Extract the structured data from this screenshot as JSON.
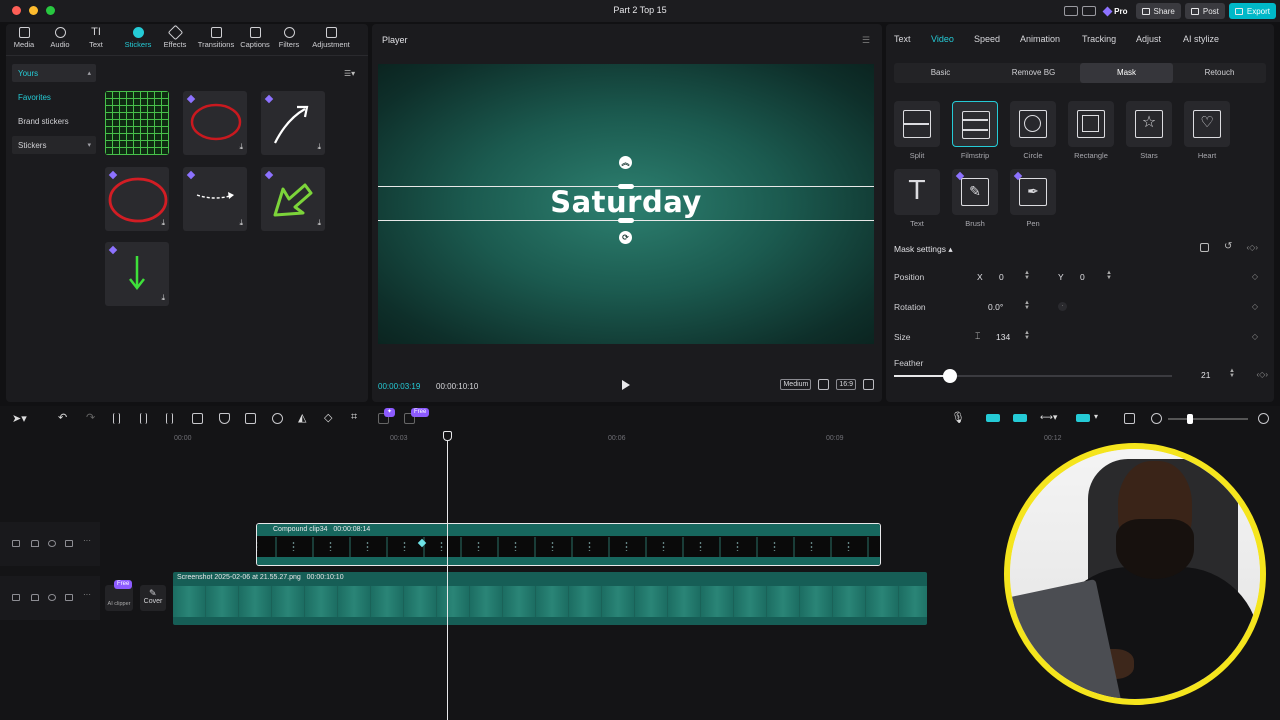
{
  "window": {
    "title": "Part 2 Top 15"
  },
  "titlebar": {
    "pro_label": "Pro",
    "share_label": "Share",
    "post_label": "Post",
    "export_label": "Export"
  },
  "library": {
    "tabs": [
      {
        "label": "Media"
      },
      {
        "label": "Audio"
      },
      {
        "label": "Text"
      },
      {
        "label": "Stickers"
      },
      {
        "label": "Effects"
      },
      {
        "label": "Transitions"
      },
      {
        "label": "Captions"
      },
      {
        "label": "Filters"
      },
      {
        "label": "Adjustment"
      }
    ],
    "active_tab": "Stickers",
    "side": {
      "yours": "Yours",
      "favorites": "Favorites",
      "brand_stickers": "Brand stickers",
      "stickers": "Stickers"
    }
  },
  "player": {
    "title": "Player",
    "canvas_text": "Saturday",
    "current_time": "00:00:03:19",
    "duration": "00:00:10:10",
    "quality": "Medium",
    "ratio": "16:9"
  },
  "props": {
    "tabs": [
      "Text",
      "Video",
      "Speed",
      "Animation",
      "Tracking",
      "Adjust",
      "AI stylize"
    ],
    "active_tab": "Video",
    "subtabs": [
      "Basic",
      "Remove BG",
      "Mask",
      "Retouch"
    ],
    "active_subtab": "Mask",
    "masks": [
      {
        "label": "Split"
      },
      {
        "label": "Filmstrip"
      },
      {
        "label": "Circle"
      },
      {
        "label": "Rectangle"
      },
      {
        "label": "Stars"
      },
      {
        "label": "Heart"
      },
      {
        "label": "Text"
      },
      {
        "label": "Brush"
      },
      {
        "label": "Pen"
      }
    ],
    "selected_mask": "Filmstrip",
    "settings_title": "Mask settings",
    "position_label": "Position",
    "x_label": "X",
    "x_value": "0",
    "y_label": "Y",
    "y_value": "0",
    "rotation_label": "Rotation",
    "rotation_value": "0.0°",
    "size_label": "Size",
    "size_value": "134",
    "feather_label": "Feather",
    "feather_value": "21"
  },
  "timeline": {
    "ruler": [
      "00:00",
      "00:03",
      "00:06",
      "00:09",
      "00:12"
    ],
    "compound_clip": {
      "name": "Compound clip34",
      "duration": "00:00:08:14"
    },
    "screenshot_clip": {
      "name": "Screenshot 2025-02-06 at 21.55.27.png",
      "duration": "00:00:10:10"
    },
    "free_badge": "Free",
    "cover_label": "Cover",
    "ai_clipper_label": "AI clipper"
  },
  "colors": {
    "accent": "#25cbd6",
    "clip": "#17675e",
    "webcam_ring": "#f5e51d",
    "pro_gem": "#8d72ff"
  }
}
